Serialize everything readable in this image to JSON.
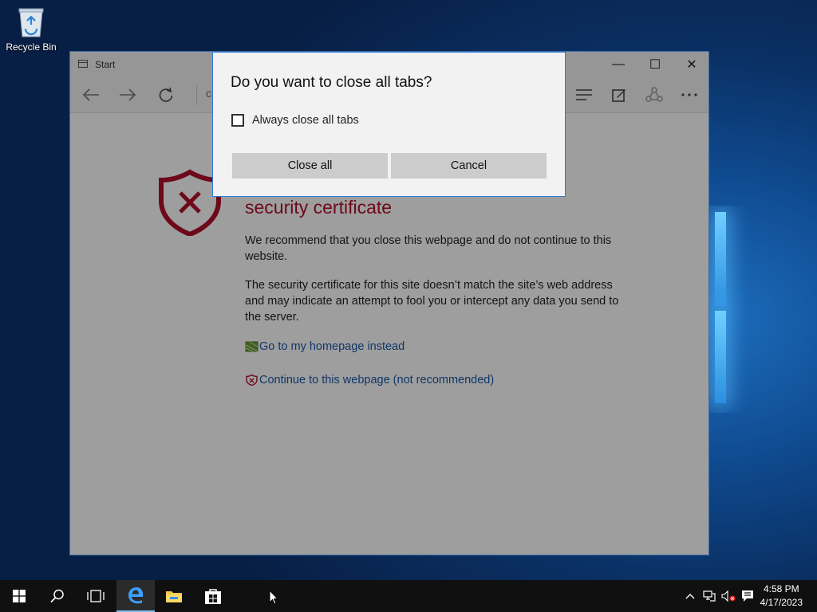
{
  "desktop": {
    "icons": [
      {
        "label": "Recycle Bin",
        "icon": "recycle-bin-icon"
      }
    ]
  },
  "browser": {
    "tab_title": "Start",
    "address_fragment": "c",
    "window_controls": {
      "minimize": "—",
      "maximize": "☐",
      "close": "✕"
    },
    "toolbar_icons": [
      "back-arrow-icon",
      "forward-arrow-icon",
      "refresh-icon",
      "hub-icon",
      "web-note-icon",
      "share-icon",
      "more-icon"
    ],
    "page": {
      "heading": "security certificate",
      "para1": "We recommend that you close this webpage and do not continue to this website.",
      "para2": "The security certificate for this site doesn’t match the site’s web address and may indicate an attempt to fool you or intercept any data you send to the server.",
      "link_home": "Go to my homepage instead",
      "link_continue": "Continue to this webpage (not recommended)"
    }
  },
  "dialog": {
    "title": "Do you want to close all tabs?",
    "checkbox_label": "Always close all tabs",
    "checkbox_checked": false,
    "close_all": "Close all",
    "cancel": "Cancel"
  },
  "taskbar": {
    "items": [
      "start-icon",
      "search-icon",
      "task-view-icon",
      "edge-icon",
      "file-explorer-icon",
      "store-icon"
    ],
    "clock": {
      "time": "4:58 PM",
      "date": "4/17/2023"
    }
  },
  "colors": {
    "accent": "#2f7ad8",
    "error_red": "#b0102a",
    "link_blue": "#1a58a8"
  }
}
